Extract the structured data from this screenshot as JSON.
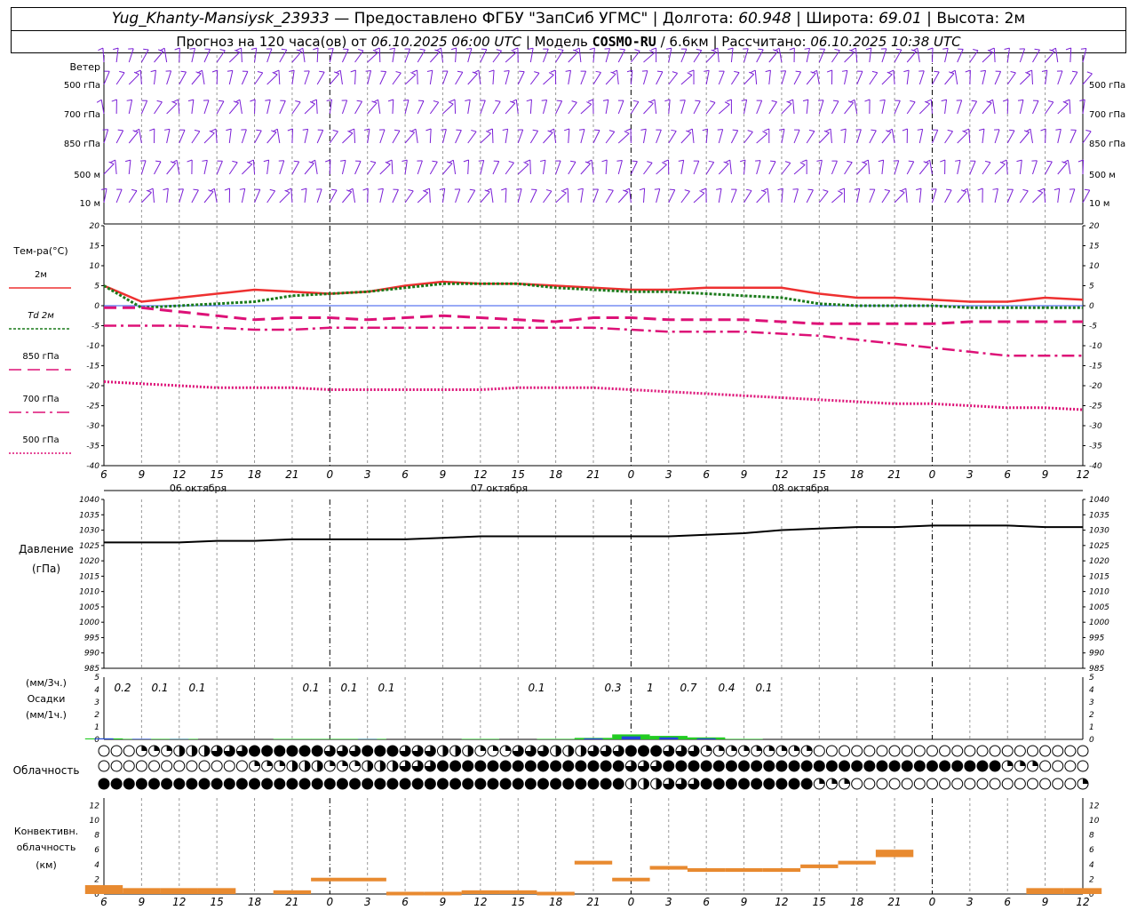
{
  "header": {
    "station": "Yug_Khanty-Mansiysk_23933",
    "provider": "— Предоставлено ФГБУ \"ЗапСиб УГМС\"",
    "lon_label": "Долгота:",
    "lon": "60.948",
    "lat_label": "Широта:",
    "lat": "69.01",
    "height_label": "Высота:",
    "height": "2м",
    "forecast_label": "Прогноз на 120 часа(ов) от",
    "forecast_time": "06.10.2025 06:00 UTC",
    "model_label": "| Модель",
    "model": "COSMO-RU",
    "resolution": "/ 6.6км",
    "calc_label": "| Рассчитано:",
    "calc_time": "06.10.2025 10:38 UTC"
  },
  "colors": {
    "wind": "#7a1fd6",
    "t2m": "#ee3030",
    "td2m": "#1a7a1a",
    "t850": "#dd1177",
    "t700": "#dd1177",
    "t500": "#dd1177",
    "pressure": "#000000",
    "precip_3h": "#22cc22",
    "precip_1h": "#2244dd",
    "conv": "#e88a30",
    "zero_line": "#3355ee"
  },
  "x_axis": {
    "hours": [
      "6",
      "9",
      "12",
      "15",
      "18",
      "21",
      "0",
      "3",
      "6",
      "9",
      "12",
      "15",
      "18",
      "21",
      "0",
      "3",
      "6",
      "9",
      "12",
      "15",
      "18",
      "21",
      "0",
      "3",
      "6",
      "9",
      "12"
    ],
    "days": [
      "06 октября",
      "07 октября",
      "08 октября"
    ]
  },
  "wind_panel": {
    "title": "Ветер",
    "levels": [
      "500 гПа",
      "700 гПа",
      "850 гПа",
      "500 м",
      "10 м"
    ]
  },
  "temp_panel": {
    "title": "Тем-ра(°С)",
    "legend": [
      {
        "label": "2м",
        "italic_prefix": ""
      },
      {
        "label": "2м",
        "italic_prefix": "Td"
      },
      {
        "label": "850 гПа",
        "italic_prefix": ""
      },
      {
        "label": "700 гПа",
        "italic_prefix": ""
      },
      {
        "label": "500 гПа",
        "italic_prefix": ""
      }
    ],
    "ticks": [
      "20",
      "15",
      "10",
      "5",
      "0",
      "-5",
      "-10",
      "-15",
      "-20",
      "-25",
      "-30",
      "-35",
      "-40"
    ]
  },
  "pressure_panel": {
    "title": "Давление",
    "unit": "(гПа)",
    "ticks": [
      "1040",
      "1035",
      "1030",
      "1025",
      "1020",
      "1015",
      "1010",
      "1005",
      "1000",
      "995",
      "990",
      "985"
    ]
  },
  "precip_panel": {
    "unit_3h": "(мм/3ч.)",
    "title": "Осадки",
    "unit_1h": "(мм/1ч.)",
    "ticks": [
      "5",
      "4",
      "3",
      "2",
      "1",
      "0"
    ],
    "labels": [
      "0.2",
      "0.1",
      "0.1",
      "0.1",
      "0.1",
      "0.1",
      "0.1",
      "0.3",
      "1",
      "0.7",
      "0.4",
      "0.1"
    ]
  },
  "cloud_panel": {
    "title": "Облачность"
  },
  "conv_panel": {
    "title1": "Конвективн.",
    "title2": "облачность",
    "unit": "(км)",
    "ticks": [
      "12",
      "10",
      "8",
      "6",
      "4",
      "2",
      "0"
    ]
  },
  "chart_data": [
    {
      "type": "line",
      "title": "Тем-ра(°С)",
      "x": [
        6,
        9,
        12,
        15,
        18,
        21,
        24,
        27,
        30,
        33,
        36,
        39,
        42,
        45,
        48,
        51,
        54,
        57,
        60,
        63,
        66,
        69,
        72,
        75,
        78,
        81,
        84
      ],
      "ylim": [
        -40,
        20
      ],
      "series": [
        {
          "name": "2м",
          "values": [
            5,
            1,
            2,
            3,
            4,
            3.5,
            3,
            3.5,
            5,
            6,
            5.5,
            5.5,
            5,
            4.5,
            4,
            4,
            4.5,
            4.5,
            4.5,
            3,
            2,
            2,
            1.5,
            1,
            1,
            2,
            1.5
          ]
        },
        {
          "name": "Td 2м",
          "values": [
            5,
            -0.5,
            0,
            0.5,
            1,
            2.5,
            3,
            3.5,
            4.5,
            5.5,
            5.5,
            5.5,
            4.5,
            4,
            3.5,
            3.5,
            3,
            2.5,
            2,
            0.5,
            0,
            0,
            0,
            -0.5,
            -0.5,
            -0.5,
            -0.5
          ]
        },
        {
          "name": "850 гПа",
          "values": [
            -0.5,
            -0.5,
            -1.5,
            -2.5,
            -3.5,
            -3,
            -3,
            -3.5,
            -3,
            -2.5,
            -3,
            -3.5,
            -4,
            -3,
            -3,
            -3.5,
            -3.5,
            -3.5,
            -4,
            -4.5,
            -4.5,
            -4.5,
            -4.5,
            -4,
            -4,
            -4,
            -4
          ]
        },
        {
          "name": "700 гПа",
          "values": [
            -5,
            -5,
            -5,
            -5.5,
            -6,
            -6,
            -5.5,
            -5.5,
            -5.5,
            -5.5,
            -5.5,
            -5.5,
            -5.5,
            -5.5,
            -6,
            -6.5,
            -6.5,
            -6.5,
            -7,
            -7.5,
            -8.5,
            -9.5,
            -10.5,
            -11.5,
            -12.5,
            -12.5,
            -12.5
          ]
        },
        {
          "name": "500 гПа",
          "values": [
            -19,
            -19.5,
            -20,
            -20.5,
            -20.5,
            -20.5,
            -21,
            -21,
            -21,
            -21,
            -21,
            -20.5,
            -20.5,
            -20.5,
            -21,
            -21.5,
            -22,
            -22.5,
            -23,
            -23.5,
            -24,
            -24.5,
            -24.5,
            -25,
            -25.5,
            -25.5,
            -26
          ]
        }
      ]
    },
    {
      "type": "line",
      "title": "Давление",
      "x": [
        6,
        9,
        12,
        15,
        18,
        21,
        24,
        27,
        30,
        33,
        36,
        39,
        42,
        45,
        48,
        51,
        54,
        57,
        60,
        63,
        66,
        69,
        72,
        75,
        78,
        81,
        84
      ],
      "ylim": [
        985,
        1040
      ],
      "series": [
        {
          "name": "Давление",
          "values": [
            1026,
            1026,
            1026,
            1026.5,
            1026.5,
            1027,
            1027,
            1027,
            1027,
            1027.5,
            1028,
            1028,
            1028,
            1028,
            1028,
            1028,
            1028.5,
            1029,
            1030,
            1030.5,
            1031,
            1031,
            1031.5,
            1031.5,
            1031.5,
            1031,
            1031
          ]
        }
      ]
    },
    {
      "type": "bar",
      "title": "Осадки",
      "x": [
        6,
        9,
        12,
        15,
        18,
        21,
        24,
        27,
        30,
        33,
        36,
        39,
        42,
        45,
        48,
        51,
        54,
        57,
        60,
        63,
        66,
        69,
        72,
        75,
        78,
        81,
        84
      ],
      "ylim": [
        0,
        5
      ],
      "series": [
        {
          "name": "(мм/3ч.)",
          "values": [
            0.2,
            0.1,
            0.1,
            0,
            0,
            0.1,
            0.1,
            0.1,
            0,
            0,
            0.1,
            0,
            0.1,
            0.3,
            1,
            0.7,
            0.4,
            0.1,
            0,
            0,
            0,
            0,
            0,
            0,
            0,
            0,
            0
          ]
        },
        {
          "name": "(мм/1ч.)",
          "values": [
            0.1,
            0.05,
            0.03,
            0,
            0,
            0,
            0,
            0.03,
            0,
            0,
            0,
            0,
            0,
            0.1,
            0.3,
            0.2,
            0.1,
            0,
            0,
            0,
            0,
            0,
            0,
            0,
            0,
            0,
            0
          ]
        }
      ]
    },
    {
      "type": "bar",
      "title": "Конвективн. облачность",
      "x": [
        6,
        9,
        12,
        15,
        18,
        21,
        24,
        27,
        30,
        33,
        36,
        39,
        42,
        45,
        48,
        51,
        54,
        57,
        60,
        63,
        66,
        69,
        72,
        75,
        78,
        81,
        84
      ],
      "ylim": [
        0,
        13
      ],
      "series": [
        {
          "name": "base",
          "values": [
            0,
            0,
            0,
            0,
            0,
            0,
            1.8,
            1.8,
            0,
            0,
            0,
            0,
            0,
            4,
            1.8,
            3.3,
            3,
            3,
            3,
            3.5,
            4,
            5,
            0,
            0,
            0,
            0,
            0
          ]
        },
        {
          "name": "top",
          "values": [
            1.2,
            0.8,
            0.8,
            0.8,
            0,
            0.5,
            2.2,
            2.2,
            0.3,
            0.3,
            0.5,
            0.5,
            0.3,
            4.5,
            2.2,
            3.8,
            3.5,
            3.5,
            3.5,
            4,
            4.5,
            6,
            0,
            0,
            0,
            0.8,
            0.8
          ]
        }
      ]
    },
    {
      "type": "table",
      "title": "Облачность",
      "rows": [
        {
          "name": "upper",
          "values": [
            0,
            1,
            2,
            3,
            4,
            4,
            3,
            4,
            3,
            2,
            1,
            3,
            2,
            3,
            4,
            3,
            1,
            1,
            1,
            0,
            0,
            0,
            0,
            0,
            0,
            0,
            0
          ]
        },
        {
          "name": "middle",
          "values": [
            0,
            0,
            0,
            0,
            1,
            2,
            1,
            2,
            3,
            4,
            4,
            4,
            4,
            4,
            3,
            4,
            4,
            4,
            4,
            4,
            4,
            4,
            4,
            4,
            1,
            0,
            0
          ]
        },
        {
          "name": "lower",
          "values": [
            4,
            4,
            4,
            4,
            4,
            4,
            4,
            4,
            4,
            4,
            4,
            4,
            4,
            4,
            2,
            3,
            4,
            4,
            4,
            1,
            0,
            0,
            0,
            0,
            0,
            0,
            1
          ]
        }
      ]
    }
  ]
}
